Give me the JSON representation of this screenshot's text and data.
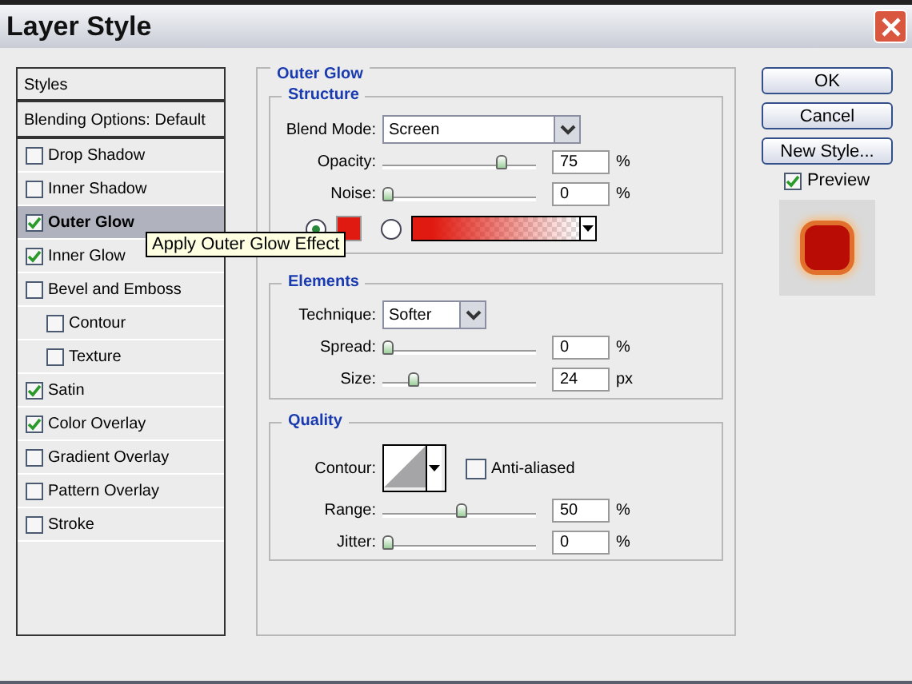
{
  "window": {
    "title": "Layer Style"
  },
  "styles": [
    {
      "label": "Styles",
      "kind": "header"
    },
    {
      "label": "Blending Options: Default",
      "kind": "header"
    },
    {
      "label": "Drop Shadow",
      "kind": "item",
      "checked": false,
      "selected": false
    },
    {
      "label": "Inner Shadow",
      "kind": "item",
      "checked": false,
      "selected": false
    },
    {
      "label": "Outer Glow",
      "kind": "item",
      "checked": true,
      "selected": true
    },
    {
      "label": "Inner Glow",
      "kind": "item",
      "checked": true,
      "selected": false
    },
    {
      "label": "Bevel and Emboss",
      "kind": "item",
      "checked": false,
      "selected": false
    },
    {
      "label": "Contour",
      "kind": "sub",
      "checked": false,
      "selected": false
    },
    {
      "label": "Texture",
      "kind": "sub",
      "checked": false,
      "selected": false
    },
    {
      "label": "Satin",
      "kind": "item",
      "checked": true,
      "selected": false
    },
    {
      "label": "Color Overlay",
      "kind": "item",
      "checked": true,
      "selected": false
    },
    {
      "label": "Gradient Overlay",
      "kind": "item",
      "checked": false,
      "selected": false
    },
    {
      "label": "Pattern Overlay",
      "kind": "item",
      "checked": false,
      "selected": false
    },
    {
      "label": "Stroke",
      "kind": "item",
      "checked": false,
      "selected": false
    }
  ],
  "tooltip": "Apply Outer Glow Effect",
  "panel": {
    "title": "Outer Glow",
    "structure": {
      "title": "Structure",
      "blend_mode": {
        "label": "Blend Mode:",
        "value": "Screen"
      },
      "sliders": [
        {
          "label": "Opacity:",
          "level": 0.77,
          "value": "75",
          "unit": "%"
        },
        {
          "label": "Noise:",
          "level": 0,
          "value": "0",
          "unit": "%"
        }
      ],
      "fill": [
        {
          "kind": "color",
          "selected": true,
          "color": "#e01a10"
        },
        {
          "kind": "gradient",
          "selected": false,
          "color": "#e01a10"
        }
      ]
    },
    "elements": {
      "title": "Elements",
      "technique": {
        "label": "Technique:",
        "value": "Softer"
      },
      "sliders": [
        {
          "label": "Spread:",
          "level": 0,
          "value": "0",
          "unit": "%"
        },
        {
          "label": "Size:",
          "level": 0.17,
          "value": "24",
          "unit": "px"
        }
      ]
    },
    "quality": {
      "title": "Quality",
      "contour_label": "Contour:",
      "anti_aliased": {
        "label": "Anti-aliased",
        "checked": false
      },
      "sliders": [
        {
          "label": "Range:",
          "level": 0.5,
          "value": "50",
          "unit": "%"
        },
        {
          "label": "Jitter:",
          "level": 0,
          "value": "0",
          "unit": "%"
        }
      ]
    }
  },
  "buttons": [
    "OK",
    "Cancel",
    "New Style..."
  ],
  "preview": {
    "label": "Preview",
    "checked": true
  }
}
